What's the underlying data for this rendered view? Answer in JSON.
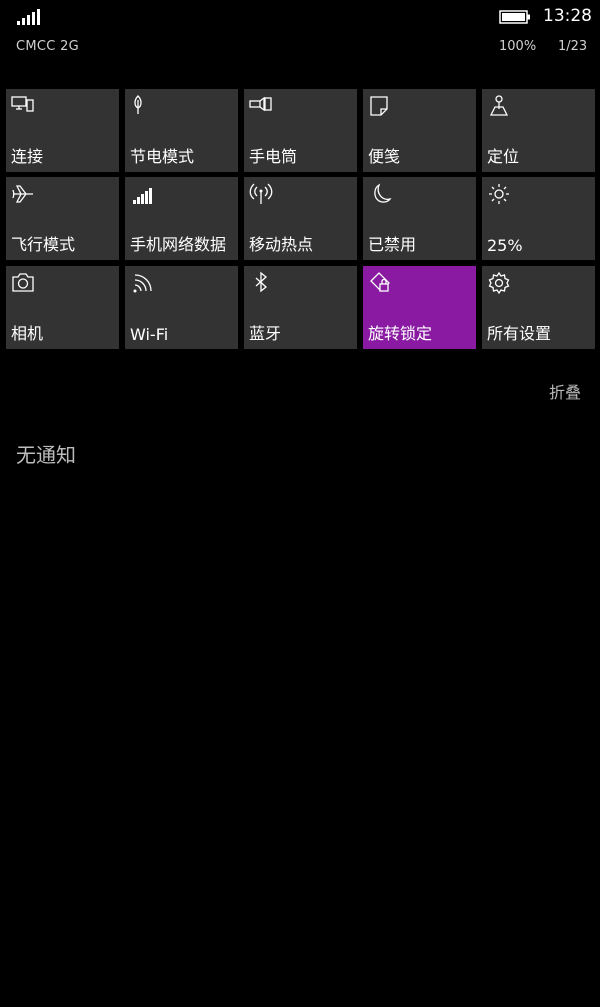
{
  "status_bar": {
    "carrier": "CMCC 2G",
    "time": "13:28",
    "battery_percent": "100%",
    "date": "1/23",
    "signal_icon": "signal-bars-icon",
    "battery_icon": "battery-icon"
  },
  "quick_actions": [
    {
      "label": "连接",
      "icon": "connect-icon",
      "active": false
    },
    {
      "label": "节电模式",
      "icon": "battery-saver-icon",
      "active": false
    },
    {
      "label": "手电筒",
      "icon": "flashlight-icon",
      "active": false
    },
    {
      "label": "便笺",
      "icon": "note-icon",
      "active": false
    },
    {
      "label": "定位",
      "icon": "location-icon",
      "active": false
    },
    {
      "label": "飞行模式",
      "icon": "airplane-icon",
      "active": false
    },
    {
      "label": "手机网络数据",
      "icon": "cellular-icon",
      "active": false
    },
    {
      "label": "移动热点",
      "icon": "hotspot-icon",
      "active": false
    },
    {
      "label": "已禁用",
      "icon": "moon-icon",
      "active": false
    },
    {
      "label": "25%",
      "icon": "brightness-icon",
      "active": false
    },
    {
      "label": "相机",
      "icon": "camera-icon",
      "active": false
    },
    {
      "label": "Wi-Fi",
      "icon": "wifi-icon",
      "active": false
    },
    {
      "label": "蓝牙",
      "icon": "bluetooth-icon",
      "active": false
    },
    {
      "label": "旋转锁定",
      "icon": "rotation-lock-icon",
      "active": true
    },
    {
      "label": "所有设置",
      "icon": "gear-icon",
      "active": false
    }
  ],
  "collapse_label": "折叠",
  "notifications": {
    "empty_text": "无通知"
  },
  "colors": {
    "background": "#000000",
    "tile": "#333333",
    "accent": "#8a1aa2"
  }
}
